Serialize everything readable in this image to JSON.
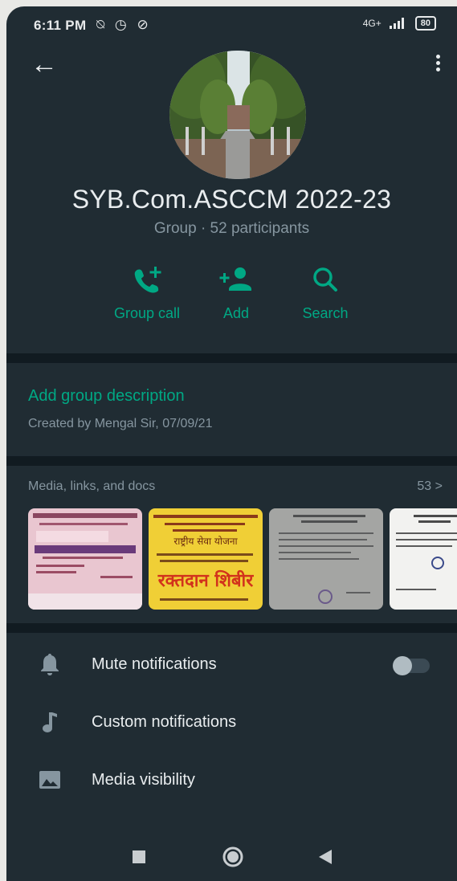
{
  "status_bar": {
    "time": "6:11 PM",
    "left_icons": "⍉ ◷ ⊘",
    "network": "4G+",
    "battery": "80"
  },
  "header": {
    "title": "SYB.Com.ASCCM 2022-23",
    "subtitle": "Group · 52 participants"
  },
  "actions": [
    {
      "label": "Group call",
      "icon": "call-add-icon"
    },
    {
      "label": "Add",
      "icon": "person-add-icon"
    },
    {
      "label": "Search",
      "icon": "search-icon"
    }
  ],
  "description": {
    "add_label": "Add group description",
    "created": "Created by Mengal Sir, 07/09/21"
  },
  "media": {
    "title": "Media, links, and docs",
    "count": "53 >",
    "thumbnails": [
      {
        "kind": "pink-poster"
      },
      {
        "kind": "yellow-poster",
        "big_text": "रक्तदान शिबीर",
        "small_text": "राष्ट्रीय सेवा योजना"
      },
      {
        "kind": "gray-document"
      },
      {
        "kind": "white-document"
      }
    ]
  },
  "settings": [
    {
      "label": "Mute notifications",
      "icon": "bell-icon",
      "toggle": false
    },
    {
      "label": "Custom notifications",
      "icon": "music-note-icon"
    },
    {
      "label": "Media visibility",
      "icon": "image-icon"
    }
  ],
  "colors": {
    "background": "#202c33",
    "accent": "#00a884",
    "primary_text": "#e9edef",
    "secondary_text": "#8696a0"
  }
}
